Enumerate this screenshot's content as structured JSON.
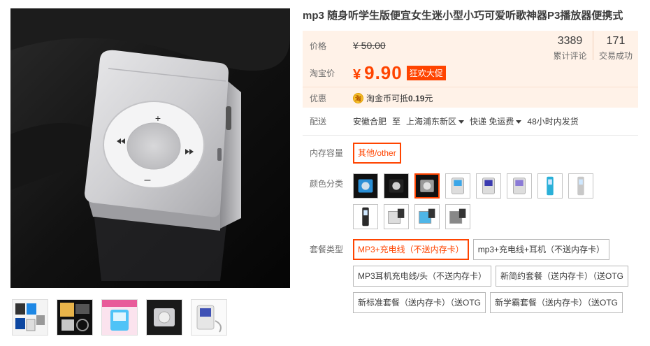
{
  "product": {
    "title": "mp3 随身听学生版便宜女生迷小型小巧可爱听歌神器P3播放器便携式"
  },
  "price": {
    "label": "价格",
    "original": "¥ 50.00"
  },
  "taobao_price": {
    "label": "淘宝价",
    "currency": "¥",
    "value": "9.90",
    "promo_tag": "狂欢大促"
  },
  "stats": {
    "reviews_count": "3389",
    "reviews_label": "累计评论",
    "sales_count": "171",
    "sales_label": "交易成功"
  },
  "discount": {
    "label": "优惠",
    "coin_glyph": "淘",
    "text_prefix": "淘金币可抵",
    "amount": "0.19",
    "text_suffix": "元"
  },
  "shipping": {
    "label": "配送",
    "origin": "安徽合肥",
    "to": "至",
    "destination": "上海浦东新区",
    "method": "快递 免运费",
    "dispatch": "48小时内发货"
  },
  "memory": {
    "label": "内存容量",
    "options": [
      "其他/other"
    ],
    "selected_index": 0
  },
  "color": {
    "label": "颜色分类",
    "selected_index": 2,
    "swatches": [
      {
        "icon": "blue-clip-mp3-icon",
        "accent": "#2a8fd6"
      },
      {
        "icon": "black-clip-mp3-icon",
        "accent": "#222222"
      },
      {
        "icon": "silver-clip-mp3-icon",
        "accent": "#9a9a9a"
      },
      {
        "icon": "blue-screen-mp3-icon",
        "accent": "#3aa6e8"
      },
      {
        "icon": "purple-screen-mp3-icon",
        "accent": "#3b3bb0"
      },
      {
        "icon": "violet-screen-mp3-icon",
        "accent": "#8a7ad6"
      },
      {
        "icon": "cyan-stick-mp3-icon",
        "accent": "#2ab0d8"
      },
      {
        "icon": "white-stick-mp3-icon",
        "accent": "#c8c8c8"
      },
      {
        "icon": "black-stick-mp3-icon",
        "accent": "#2a2a2a"
      },
      {
        "icon": "white-box-mp3-icon",
        "accent": "#dddddd"
      },
      {
        "icon": "sky-box-mp3-icon",
        "accent": "#4fb6e8"
      },
      {
        "icon": "gray-box-mp3-icon",
        "accent": "#888888"
      }
    ]
  },
  "package": {
    "label": "套餐类型",
    "options": [
      "MP3+充电线（不送内存卡）",
      "mp3+充电线+耳机（不送内存卡）",
      "MP3耳机充电线/头（不送内存卡）",
      "新简约套餐（送内存卡）（送OTG",
      "新标准套餐（送内存卡）（送OTG",
      "新学霸套餐（送内存卡）（送OTG"
    ],
    "selected_index": 0
  },
  "thumbnails": [
    {
      "icon": "mp3-colors-thumbnail"
    },
    {
      "icon": "mp3-package-thumbnail"
    },
    {
      "icon": "mp3-pink-thumbnail"
    },
    {
      "icon": "mp3-silver-thumbnail"
    },
    {
      "icon": "mp3-screen-thumbnail"
    }
  ],
  "colors": {
    "accent": "#ff4400",
    "price_bg": "#fff2e8"
  }
}
